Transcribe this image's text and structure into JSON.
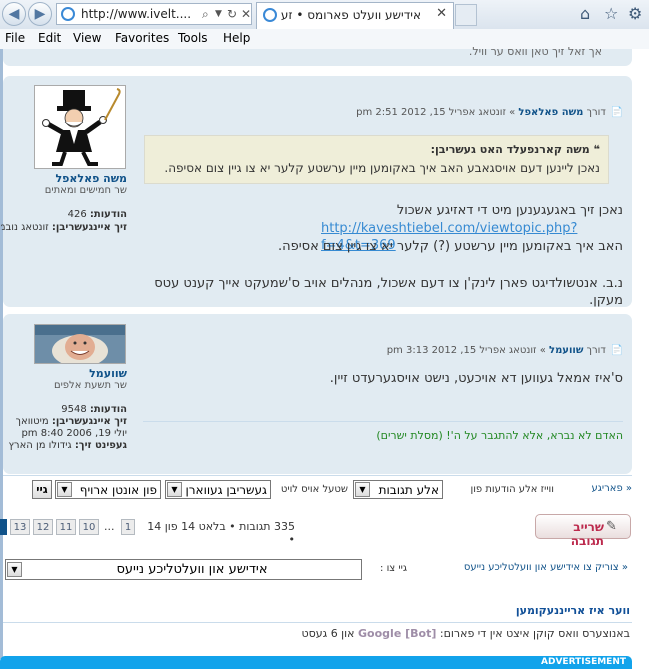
{
  "browser": {
    "address": "http://www.ivelt....",
    "tab_title": "אידישע וועלט פארומס • זע...",
    "menu": [
      "File",
      "Edit",
      "View",
      "Favorites",
      "Tools",
      "Help"
    ]
  },
  "prev_post_tail": "אך זאל זיך טאן וואס ער וויל.",
  "posts": [
    {
      "author": "משה פאלאפל",
      "rank": "שר חמישים ומאתים",
      "posts_label": "הודעות:",
      "posts_count": "426",
      "joined_label": "זיך איינגעשריבן:",
      "joined_value": "זונטאג נובמבער 21, 2010 1:59 pm",
      "meta_prefix": "דורך",
      "meta_author": "משה פאלאפל",
      "meta_date": "» זונטאג אפריל 15, 2012 2:51 pm",
      "quote_name": "משה קארנפעלד האט געשריבן:",
      "quote_text": "נאכן ליינען דעם אויסגאבע האב איך באקומען מיין ערשטע קלער יא צו גיין צום אסיפה.",
      "body_line1": "נאכן זיך באגעגענען מיט די דאזיגע אשכול",
      "body_link": "http://kaveshtiebel.com/viewtopic.php?f=4&t=369",
      "body_line2": "האב איך באקומען מיין ערשטע (?) קלער יא צו גיין צום אסיפה.",
      "body_line3": "נ.ב. אנטשולדיגט פארן לינק'ן צו דעם אשכול, מנהלים אויב ס'שמעקט אייך קענט עטס מעקן."
    },
    {
      "author": "שוועמל",
      "rank": "שר תשעת אלפים",
      "posts_label": "הודעות:",
      "posts_count": "9548",
      "joined_label": "זיך איינגעשריבן:",
      "joined_value": "מיטוואך יולי 19, 2006 8:40 pm",
      "location_label": "געפינט זיך:",
      "location_value": "גידולו מן הארץ",
      "meta_prefix": "דורך",
      "meta_author": "שוועמל",
      "meta_date": "» זונטאג אפריל 15, 2012 3:13 pm",
      "body_line1": "ס'איז אמאל געווען דא אויכעט, נישט אויסגערעדט זיין.",
      "signature": "האדם לא נברא, אלא להתגבר על ה'! (מסלת ישרים)"
    }
  ],
  "sort_bar": {
    "prev_label": "« פאריגע",
    "show_label": "ווייז אלע הודעות פון",
    "show_value": "אלע תגובות",
    "sort_label": "שטעל אויס לויט",
    "sort_value": "געשריבן געווארן",
    "dir_value": "פון אונטן ארויף",
    "go_label": "גיי"
  },
  "pagination": {
    "summary": "335 תגובות • בלאט 14 פון 14 •",
    "pages": [
      "1",
      "...",
      "10",
      "11",
      "12",
      "13"
    ]
  },
  "reply_button": "שרייב תגובה",
  "jump": {
    "back_link": "« צוריק צו אידישע און וועלטליכע נייעס",
    "goto_label": "גיי צו :",
    "goto_value": "אידישע און וועלטליכע נייעס"
  },
  "online": {
    "title": "ווער איז ארייננעקומען",
    "text_prefix": "באנוצערס וואס קוקן איצט אין די פארום:",
    "bot": "Google [Bot]",
    "text_suffix": "און 6 געסט"
  },
  "footer_label": "ADVERTISEMENT"
}
